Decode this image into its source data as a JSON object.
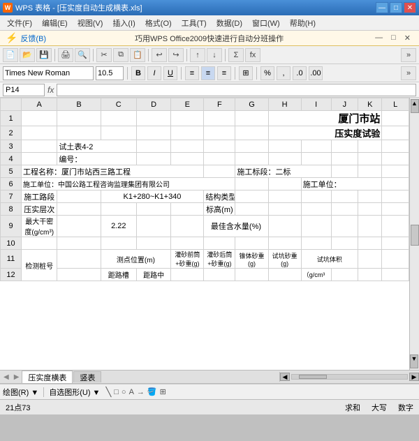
{
  "titleBar": {
    "title": "WPS 表格 - [压实度自动生成横表.xls]",
    "icon": "W",
    "buttons": [
      "—",
      "□",
      "✕"
    ]
  },
  "menuBar": {
    "items": [
      "文件(F)",
      "编辑(E)",
      "视图(V)",
      "插入(I)",
      "格式(O)",
      "工具(T)",
      "数据(D)",
      "窗口(W)",
      "帮助(H)"
    ]
  },
  "notifBar": {
    "icon": "⚡",
    "label": "反馈(B)",
    "message": "巧用WPS Office2009快速进行自动分班操作",
    "buttons": [
      "—",
      "□",
      "✕"
    ]
  },
  "formatBar": {
    "font": "Times New Roman",
    "size": "10.5",
    "boldLabel": "B",
    "italicLabel": "I",
    "underlineLabel": "U"
  },
  "formulaBar": {
    "cellRef": "P14",
    "fxLabel": "fx"
  },
  "sheet": {
    "columns": [
      "A",
      "B",
      "C",
      "D",
      "E",
      "F",
      "G",
      "H",
      "I",
      "J",
      "K",
      "L"
    ],
    "rows": [
      {
        "num": "1",
        "cells": {
          "A": "",
          "B": "",
          "C": "",
          "D": "",
          "E": "",
          "F": "",
          "G": "",
          "H": "",
          "I": "",
          "J": "厦门市站",
          "K": "",
          "L": ""
        }
      },
      {
        "num": "2",
        "cells": {
          "A": "",
          "B": "",
          "C": "",
          "D": "",
          "E": "",
          "F": "",
          "G": "",
          "H": "",
          "I": "",
          "J": "压实度试验",
          "K": "",
          "L": ""
        }
      },
      {
        "num": "3",
        "cells": {
          "A": "",
          "B": "试土表4-2",
          "C": "",
          "D": "",
          "E": "",
          "F": "",
          "G": "",
          "H": "",
          "I": "",
          "J": "",
          "K": "",
          "L": ""
        }
      },
      {
        "num": "4",
        "cells": {
          "A": "",
          "B": "编号：",
          "C": "",
          "D": "",
          "E": "",
          "F": "",
          "G": "",
          "H": "",
          "I": "",
          "J": "",
          "K": "",
          "L": ""
        }
      },
      {
        "num": "5",
        "cells": {
          "A": "工程名称：厦门市站西三路工程",
          "B": "",
          "C": "",
          "D": "",
          "E": "",
          "F": "",
          "G": "施工标段：二标",
          "H": "",
          "I": "",
          "J": "",
          "K": "",
          "L": ""
        }
      },
      {
        "num": "6",
        "cells": {
          "A": "施工单位：中国公路工程咨询监理集团有限公司",
          "B": "",
          "C": "",
          "D": "",
          "E": "",
          "F": "",
          "G": "",
          "H": "",
          "I": "施工单位：",
          "J": "",
          "K": "",
          "L": ""
        }
      },
      {
        "num": "7",
        "cells": {
          "A": "施工路段",
          "B": "",
          "C": "K1+280~K1+340",
          "D": "",
          "E": "",
          "F": "结构类型",
          "G": "",
          "H": "",
          "I": "",
          "J": "",
          "K": "",
          "L": ""
        }
      },
      {
        "num": "8",
        "cells": {
          "A": "压实层次",
          "B": "",
          "C": "",
          "D": "",
          "E": "",
          "F": "标高(m)",
          "G": "",
          "H": "",
          "I": "",
          "J": "",
          "K": "",
          "L": ""
        }
      },
      {
        "num": "9",
        "cells": {
          "A": "最大干密度(g/cm³)",
          "B": "",
          "C": "2.22",
          "D": "",
          "E": "",
          "F": "最佳含水量(%)",
          "G": "",
          "H": "",
          "I": "",
          "J": "",
          "K": "",
          "L": ""
        }
      },
      {
        "num": "10",
        "cells": {
          "A": "",
          "B": "",
          "C": "",
          "D": "",
          "E": "",
          "F": "",
          "G": "",
          "H": "",
          "I": "",
          "J": "",
          "K": "",
          "L": ""
        }
      },
      {
        "num": "11",
        "cells": {
          "A": "检测桩号",
          "B": "",
          "C": "测点位置(m)",
          "D": "",
          "E": "灌砂前筒+砂重(g)",
          "F": "灌砂后筒+砂重(g)",
          "G": "锥体砂重(g)",
          "H": "试坑砂重(g)",
          "I": "试坑体积",
          "J": "",
          "K": "",
          "L": ""
        }
      },
      {
        "num": "12",
        "cells": {
          "A": "",
          "B": "",
          "C": "距路槽",
          "D": "距路中",
          "E": "",
          "F": "",
          "G": "",
          "H": "",
          "I": "",
          "J": "",
          "K": "",
          "L": ""
        }
      }
    ]
  },
  "sheetTabs": {
    "active": "压实度横表",
    "inactive": [
      "竖表"
    ]
  },
  "statusBar": {
    "left": "绘图(R) ▼",
    "drawLabel": "自选图形(U) ▼",
    "coords": "21点73",
    "middle1": "求和",
    "middle2": "大写",
    "middle3": "数字"
  }
}
